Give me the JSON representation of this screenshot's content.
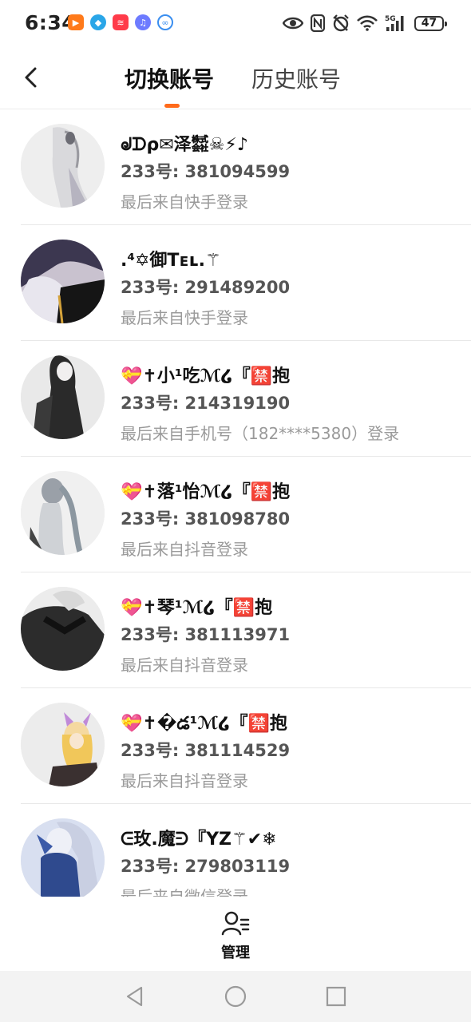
{
  "status_bar": {
    "time": "6:34",
    "apps": [
      "kuaishou-app-icon",
      "app-icon-blue",
      "app-icon-red",
      "music-app-icon",
      "app-icon-chat"
    ],
    "signal": "5G",
    "battery": "47"
  },
  "header": {
    "tabs": [
      {
        "label": "切换账号",
        "active": true
      },
      {
        "label": "历史账号",
        "active": false
      }
    ],
    "accent_color": "#ff6a1a"
  },
  "accounts": [
    {
      "name": "ᖙᗪρ✉泽㍿☠⚡♪",
      "uid": "233号: 381094599",
      "source": "最后来自快手登录"
    },
    {
      "name": ".⁴✡御Tᴇʟ.⚚",
      "uid": "233号: 291489200",
      "source": "最后来自快手登录"
    },
    {
      "name": "💝✝小¹吃ℳ໒『🈲抱",
      "uid": "233号: 214319190",
      "source": "最后来自手机号（182****5380）登录"
    },
    {
      "name": "💝✝落¹怡ℳ໒『🈲抱",
      "uid": "233号: 381098780",
      "source": "最后来自抖音登录"
    },
    {
      "name": "💝✝琴¹ℳ໒『🈲抱",
      "uid": "233号: 381113971",
      "source": "最后来自抖音登录"
    },
    {
      "name": "💝✝�డ¹ℳ໒『🈲抱",
      "uid": "233号: 381114529",
      "source": "最后来自抖音登录"
    },
    {
      "name": "ᕮ玫.魔ᕭ『YZ⚚✔❄",
      "uid": "233号: 279803119",
      "source": "最后来自微信登录"
    }
  ],
  "bottom": {
    "manage_label": "管理"
  }
}
